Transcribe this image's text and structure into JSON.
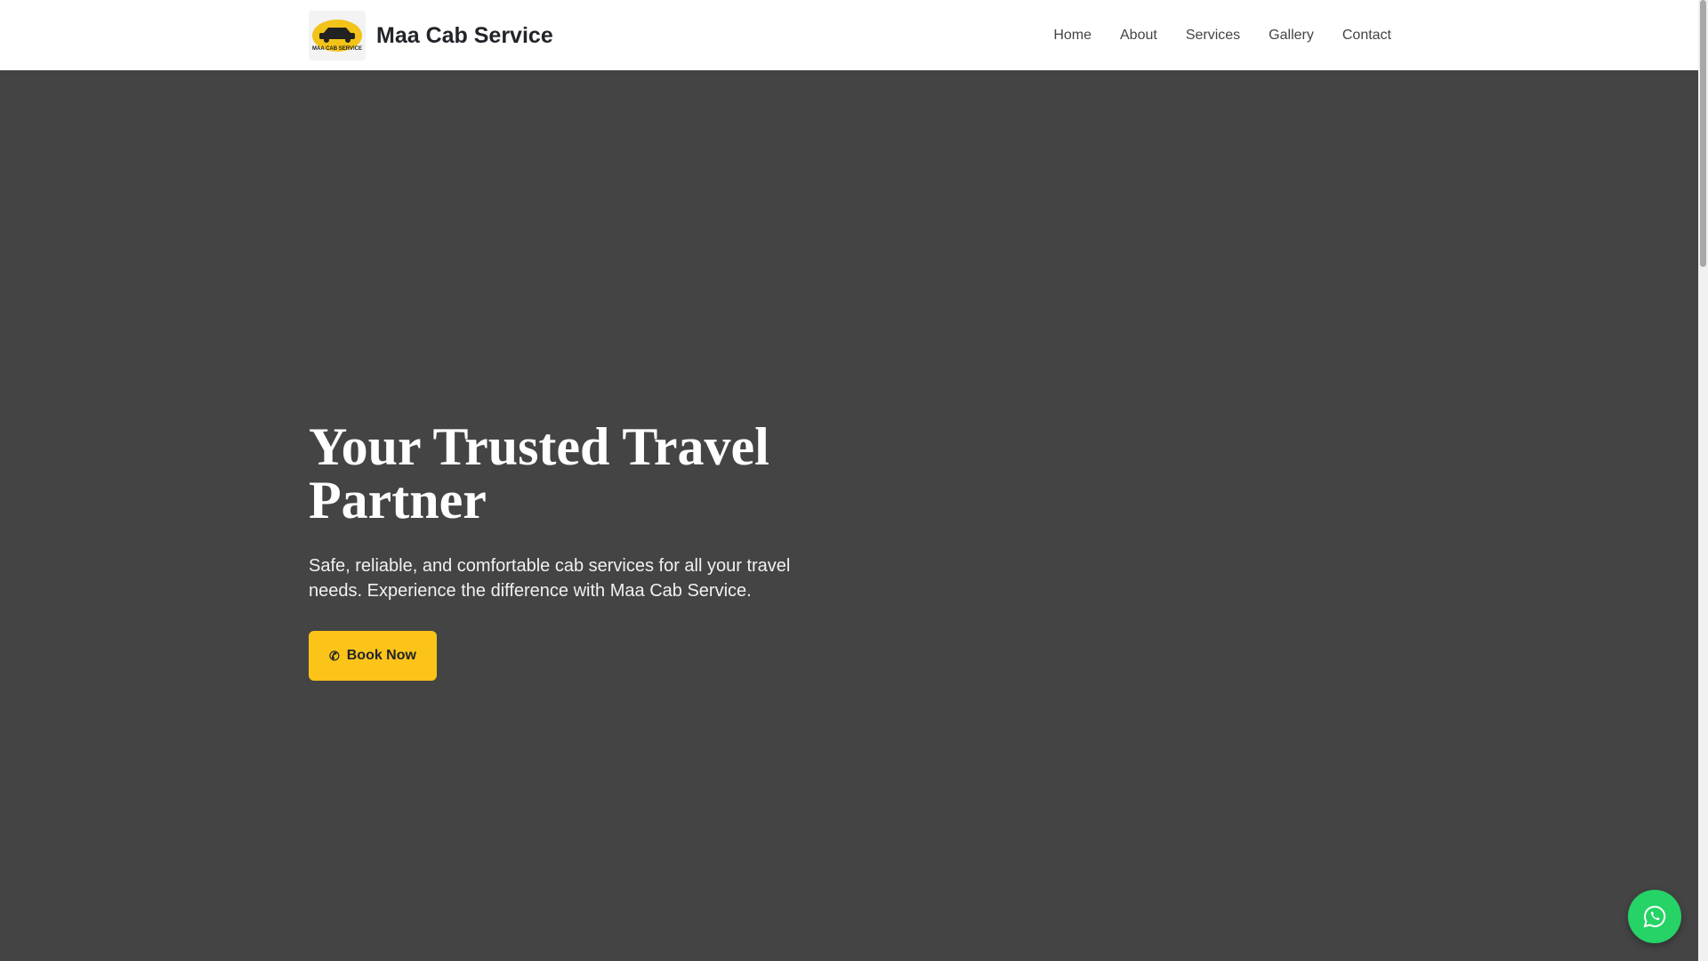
{
  "header": {
    "brand_name": "Maa Cab Service",
    "logo_text": "MAA CAB SERVICE",
    "nav_items": [
      "Home",
      "About",
      "Services",
      "Gallery",
      "Contact"
    ]
  },
  "hero": {
    "title": "Your Trusted Travel Partner",
    "subtitle": "Safe, reliable, and comfortable cab services for all your travel needs. Experience the difference with Maa Cab Service.",
    "cta_label": "Book Now",
    "cta_icon": "phone-icon"
  },
  "floating": {
    "whatsapp_icon": "whatsapp-icon"
  },
  "colors": {
    "hero_background": "#444444",
    "accent": "#fcc419",
    "whatsapp": "#25d366",
    "nav_text": "#444444"
  }
}
